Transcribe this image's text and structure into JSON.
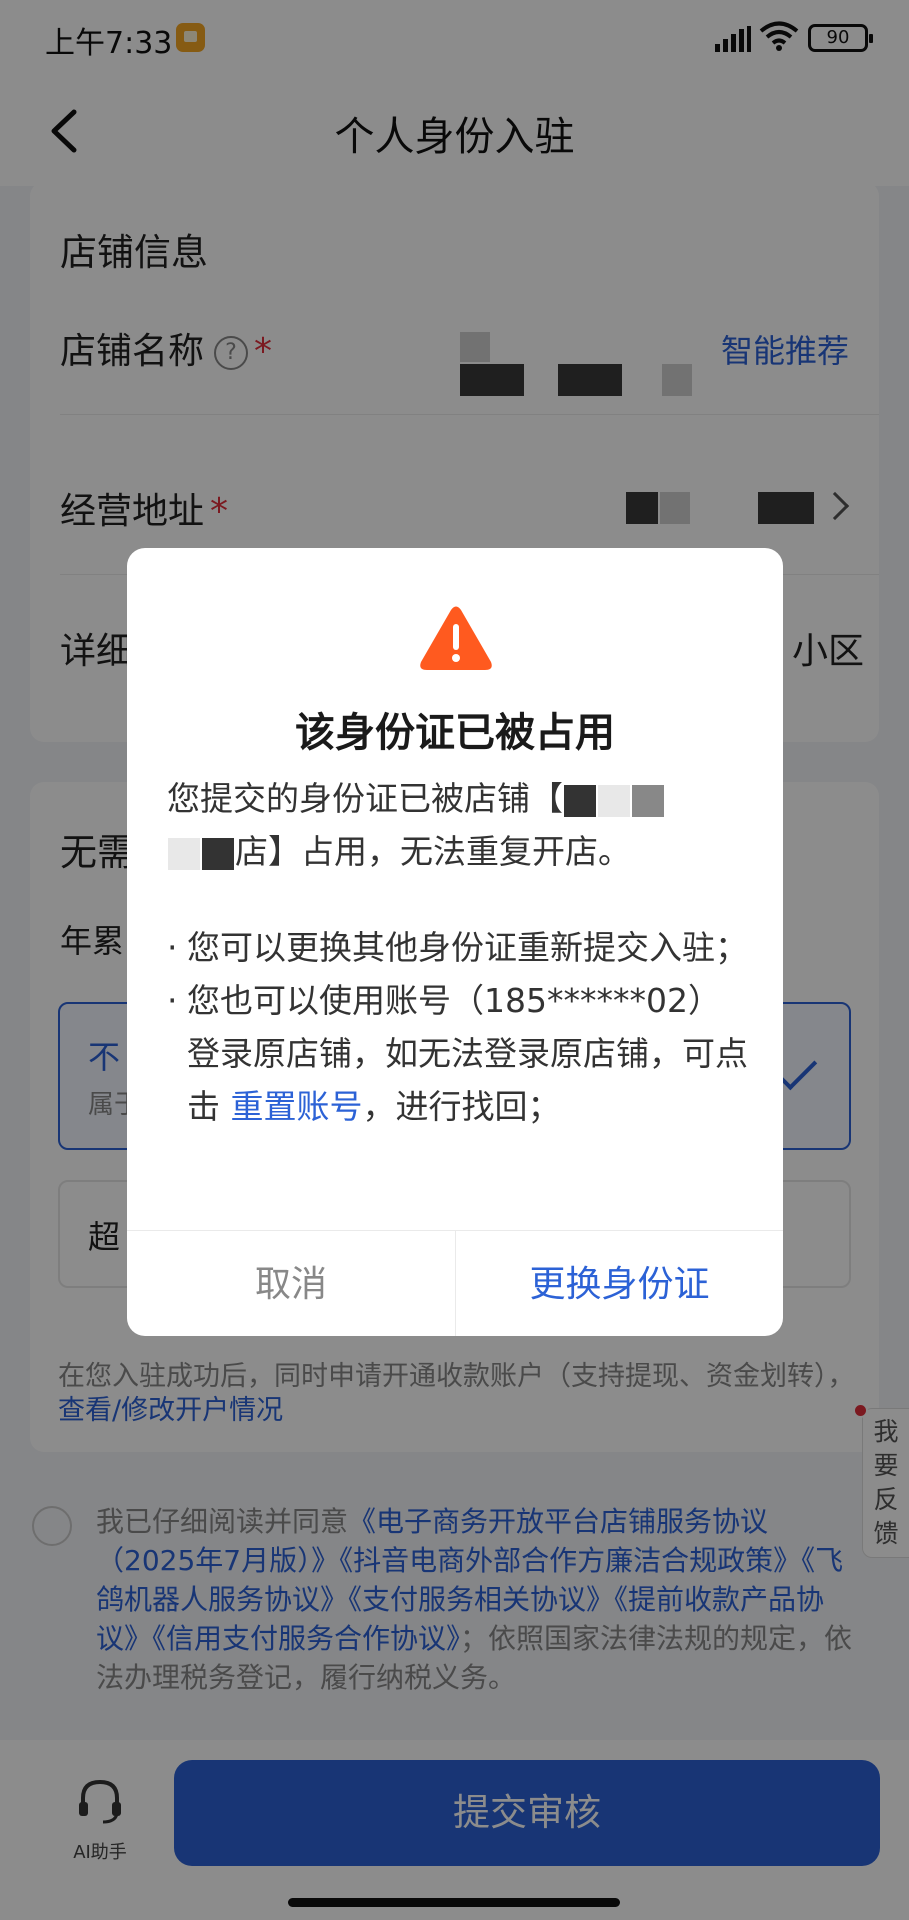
{
  "status_bar": {
    "time": "上午7:33",
    "battery": "90"
  },
  "navbar": {
    "title": "个人身份入驻"
  },
  "store_info": {
    "section_title": "店铺信息",
    "name_label": "店铺名称",
    "help_glyph": "?",
    "required_mark": "*",
    "smart_recommend": "智能推荐",
    "address_label": "经营地址",
    "detail_label_partial": "详细",
    "detail_value_partial": "小区"
  },
  "fees": {
    "section_title_partial": "无需",
    "yearly_partial": "年累",
    "option_title_partial": "不",
    "option_subtitle_partial": "属于",
    "option2_partial": "超",
    "account_note": "在您入驻成功后，同时申请开通收款账户（支持提现、资金划转），",
    "account_link": "查看/修改开户情况"
  },
  "agreement": {
    "prefix": "我已仔细阅读并同意",
    "links": [
      "《电子商务开放平台店铺服务协议（2025年7月版）》",
      "《抖音电商外部合作方廉洁合规政策》",
      "《飞鸽机器人服务协议》",
      "《支付服务相关协议》",
      "《提前收款产品协议》",
      "《信用支付服务合作协议》"
    ],
    "suffix": "；依照国家法律法规的规定，依法办理税务登记，履行纳税义务。"
  },
  "feedback": {
    "chars": [
      "我",
      "要",
      "反",
      "馈"
    ]
  },
  "bottom": {
    "ai_label": "AI助手",
    "submit": "提交审核"
  },
  "dialog": {
    "title": "该身份证已被占用",
    "line1": "您提交的身份证已被店铺【",
    "line2_tail": "店】占用，无法重复开店。",
    "bullet1": "您可以更换其他身份证重新提交入驻；",
    "bullet2_prefix": "您也可以使用账号（185******02）登录原店铺，如无法登录原店铺，可点击",
    "bullet2_link": "重置账号",
    "bullet2_suffix": "，进行找回；",
    "cancel": "取消",
    "confirm": "更换身份证"
  },
  "colors": {
    "accent": "#2c62d6",
    "warning": "#ff5a1f",
    "required": "#e02e3b"
  }
}
